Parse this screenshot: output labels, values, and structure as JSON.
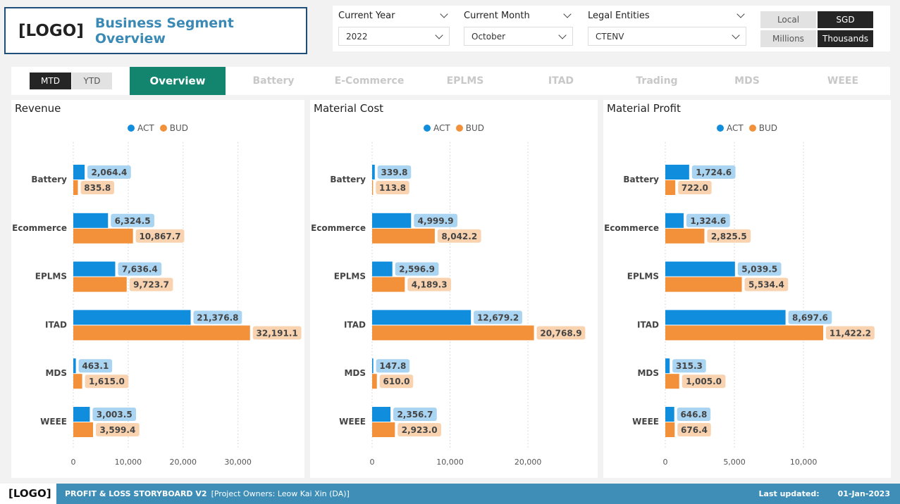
{
  "header": {
    "logo": "[LOGO]",
    "title": "Business Segment Overview"
  },
  "filters": [
    {
      "label": "Current Year",
      "value": "2022"
    },
    {
      "label": "Current Month",
      "value": "October"
    },
    {
      "label": "Legal Entities",
      "value": "CTENV"
    }
  ],
  "currency_toggle": {
    "local": "Local",
    "sgd": "SGD",
    "selected": "SGD"
  },
  "unit_toggle": {
    "millions": "Millions",
    "thousands": "Thousands",
    "selected": "Thousands"
  },
  "period_toggle": {
    "mtd": "MTD",
    "ytd": "YTD",
    "selected": "MTD"
  },
  "tabs": [
    "Overview",
    "Battery",
    "E-Commerce",
    "EPLMS",
    "ITAD",
    "Trading",
    "MDS",
    "WEEE"
  ],
  "active_tab": "Overview",
  "colors": {
    "act": "#118dde",
    "bud": "#f2913a",
    "act_label_bg": "#a9d4f2",
    "bud_label_bg": "#f9d3b0",
    "tab_active": "#13856f",
    "footer": "#3e8eb8"
  },
  "chart_data": [
    {
      "type": "bar",
      "orientation": "horizontal",
      "title": "Revenue",
      "categories": [
        "Battery",
        "Ecommerce",
        "EPLMS",
        "ITAD",
        "MDS",
        "WEEE"
      ],
      "series": [
        {
          "name": "ACT",
          "values": [
            2064.4,
            6324.5,
            7636.4,
            21376.8,
            463.1,
            3003.5
          ],
          "labels": [
            "2,064.4",
            "6,324.5",
            "7,636.4",
            "21,376.8",
            "463.1",
            "3,003.5"
          ]
        },
        {
          "name": "BUD",
          "values": [
            835.8,
            10867.7,
            9723.7,
            32191.1,
            1615.0,
            3599.4
          ],
          "labels": [
            "835.8",
            "10,867.7",
            "9,723.7",
            "32,191.1",
            "1,615.0",
            "3,599.4"
          ]
        }
      ],
      "xticks": [
        0,
        10000,
        20000,
        30000
      ],
      "xtick_labels": [
        "0",
        "10,000",
        "20,000",
        "30,000"
      ],
      "xlim": [
        0,
        38000
      ],
      "grid": true,
      "legend": "top-center"
    },
    {
      "type": "bar",
      "orientation": "horizontal",
      "title": "Material Cost",
      "categories": [
        "Battery",
        "Ecommerce",
        "EPLMS",
        "ITAD",
        "MDS",
        "WEEE"
      ],
      "series": [
        {
          "name": "ACT",
          "values": [
            339.8,
            4999.9,
            2596.9,
            12679.2,
            147.8,
            2356.7
          ],
          "labels": [
            "339.8",
            "4,999.9",
            "2,596.9",
            "12,679.2",
            "147.8",
            "2,356.7"
          ]
        },
        {
          "name": "BUD",
          "values": [
            113.8,
            8042.2,
            4189.3,
            20768.9,
            610.0,
            2923.0
          ],
          "labels": [
            "113.8",
            "8,042.2",
            "4,189.3",
            "20,768.9",
            "610.0",
            "2,923.0"
          ]
        }
      ],
      "xticks": [
        0,
        10000,
        20000
      ],
      "xtick_labels": [
        "0",
        "10,000",
        "20,000"
      ],
      "xlim": [
        0,
        27500
      ],
      "grid": true,
      "legend": "top-center"
    },
    {
      "type": "bar",
      "orientation": "horizontal",
      "title": "Material Profit",
      "categories": [
        "Battery",
        "Ecommerce",
        "EPLMS",
        "ITAD",
        "MDS",
        "WEEE"
      ],
      "series": [
        {
          "name": "ACT",
          "values": [
            1724.6,
            1324.6,
            5039.5,
            8697.6,
            315.3,
            646.8
          ],
          "labels": [
            "1,724.6",
            "1,324.6",
            "5,039.5",
            "8,697.6",
            "315.3",
            "646.8"
          ]
        },
        {
          "name": "BUD",
          "values": [
            722.0,
            2825.5,
            5534.4,
            11422.2,
            1005.0,
            676.4
          ],
          "labels": [
            "722.0",
            "2,825.5",
            "5,534.4",
            "11,422.2",
            "1,005.0",
            "676.4"
          ]
        }
      ],
      "xticks": [
        0,
        5000,
        10000
      ],
      "xtick_labels": [
        "0",
        "5,000",
        "10,000"
      ],
      "xlim": [
        0,
        15500
      ],
      "grid": true,
      "legend": "top-center"
    }
  ],
  "footer": {
    "logo": "[LOGO]",
    "app_name": "PROFIT & LOSS STORYBOARD V2",
    "owners": "[Project Owners: Leow Kai Xin (DA)]",
    "updated_label": "Last updated:",
    "updated_value": "01-Jan-2023"
  }
}
